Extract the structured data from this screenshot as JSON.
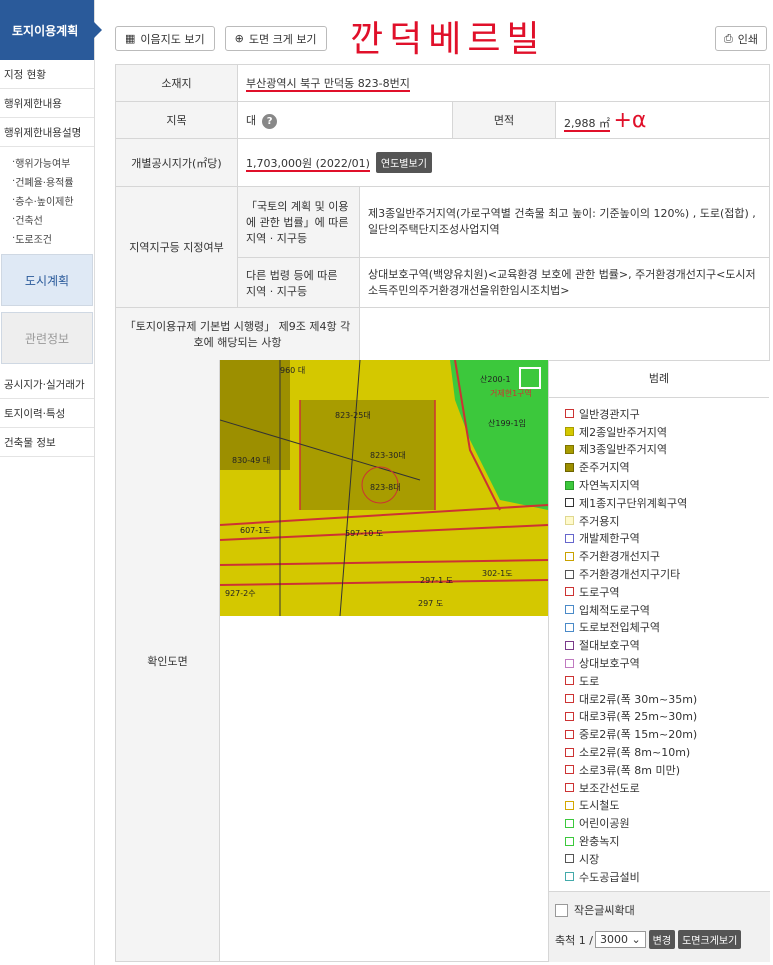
{
  "sidebar": {
    "title": "토지이용계획",
    "items": [
      {
        "label": "지정 현황"
      },
      {
        "label": "행위제한내용"
      },
      {
        "label": "행위제한내용설명"
      }
    ],
    "subitems": [
      "행위가능여부",
      "건폐율·용적률",
      "층수·높이제한",
      "건축선",
      "도로조건"
    ],
    "box1": "도시계획",
    "box2": "관련정보",
    "items2": [
      "공시지가·실거래가",
      "토지이력·특성",
      "건축물 정보"
    ]
  },
  "toolbar": {
    "map_label": "이음지도 보기",
    "zoom_label": "도면 크게 보기",
    "print_label": "인쇄"
  },
  "handnote": "깐덕베르빌",
  "info": {
    "address_label": "소재지",
    "address_value": "부산광역시 북구 만덕동 823-8번지",
    "jimok_label": "지목",
    "jimok_value": "대",
    "area_label": "면적",
    "area_value": "2,988 ㎡",
    "area_note": "+α",
    "price_label": "개별공시지가(㎡당)",
    "price_value": "1,703,000원 (2022/01)",
    "price_btn": "연도별보기",
    "zone_label": "지역지구등 지정여부",
    "zone1_label": "「국토의 계획 및 이용에 관한 법률」에 따른 지역 · 지구등",
    "zone1_value": "제3종일반주거지역(가로구역별 건축물 최고 높이: 기준높이의 120%) , 도로(접합) , 일단의주택단지조성사업지역",
    "zone2_label": "다른 법령 등에 따른 지역 · 지구등",
    "zone2_value": "상대보호구역(백양유치원)<교육환경 보호에 관한 법률>, 주거환경개선지구<도시저소득주민의주거환경개선을위한임시조치법>",
    "rule_label": "「토지이용규제 기본법 시행령」 제9조 제4항 각 호에 해당되는 사항",
    "confirm_label": "확인도면"
  },
  "legend": {
    "title": "범례",
    "items": [
      {
        "label": "일반경관지구",
        "color": "#ffffff",
        "border": "#c33"
      },
      {
        "label": "제2종일반주거지역",
        "color": "#d4c800",
        "border": "#a89c00"
      },
      {
        "label": "제3종일반주거지역",
        "color": "#a89c00",
        "border": "#7d7300"
      },
      {
        "label": "준주거지역",
        "color": "#9c8f00",
        "border": "#6d6300"
      },
      {
        "label": "자연녹지지역",
        "color": "#3cc83c",
        "border": "#2a9a2a"
      },
      {
        "label": "제1종지구단위계획구역",
        "color": "#ffffff",
        "border": "#333"
      },
      {
        "label": "주거용지",
        "color": "#fffacd",
        "border": "#e0d890"
      },
      {
        "label": "개발제한구역",
        "color": "#ffffff",
        "border": "#6666cc"
      },
      {
        "label": "주거환경개선지구",
        "color": "#ffffff",
        "border": "#c9a200"
      },
      {
        "label": "주거환경개선지구기타",
        "color": "#ffffff",
        "border": "#555"
      },
      {
        "label": "도로구역",
        "color": "#ffffff",
        "border": "#c33"
      },
      {
        "label": "입체적도로구역",
        "color": "#ffffff",
        "border": "#4a8ac8"
      },
      {
        "label": "도로보전입체구역",
        "color": "#ffffff",
        "border": "#4a8ac8"
      },
      {
        "label": "절대보호구역",
        "color": "#ffffff",
        "border": "#7a3a8a"
      },
      {
        "label": "상대보호구역",
        "color": "#ffffff",
        "border": "#c07ac0"
      },
      {
        "label": "도로",
        "color": "#ffffff",
        "border": "#c33"
      },
      {
        "label": "대로2류(폭 30m~35m)",
        "color": "#ffffff",
        "border": "#c33"
      },
      {
        "label": "대로3류(폭 25m~30m)",
        "color": "#ffffff",
        "border": "#c33"
      },
      {
        "label": "중로2류(폭 15m~20m)",
        "color": "#ffffff",
        "border": "#c33"
      },
      {
        "label": "소로2류(폭 8m~10m)",
        "color": "#ffffff",
        "border": "#c33"
      },
      {
        "label": "소로3류(폭 8m 미만)",
        "color": "#ffffff",
        "border": "#c33"
      },
      {
        "label": "보조간선도로",
        "color": "#ffffff",
        "border": "#c33"
      },
      {
        "label": "도시철도",
        "color": "#ffffff",
        "border": "#d4a800"
      },
      {
        "label": "어린이공원",
        "color": "#ffffff",
        "border": "#3cc83c"
      },
      {
        "label": "완충녹지",
        "color": "#ffffff",
        "border": "#3cc83c"
      },
      {
        "label": "시장",
        "color": "#ffffff",
        "border": "#555"
      },
      {
        "label": "수도공급설비",
        "color": "#ffffff",
        "border": "#4aa"
      }
    ],
    "small_font_label": "작은글씨확대",
    "scale_label": "축척 1 /",
    "scale_value": "3000",
    "change_btn": "변경",
    "zoom_btn": "도면크게보기"
  },
  "map": {
    "labels": [
      "960 대",
      "823-25대",
      "823-30대",
      "823-8대",
      "830-49 대",
      "597-10 도",
      "607-1도",
      "297-1 도",
      "302-1도",
      "927-2수",
      "297 도",
      "산200-1",
      "산199-1임",
      "거제현1구역"
    ]
  }
}
